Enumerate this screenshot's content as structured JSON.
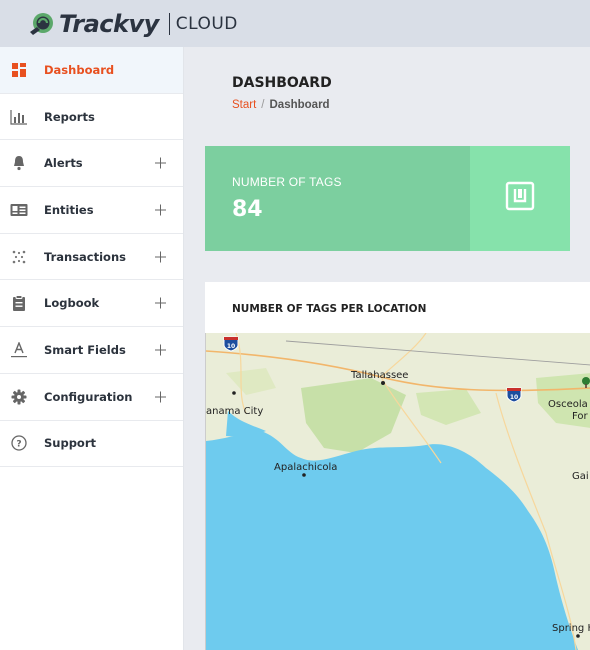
{
  "brand": {
    "name": "Trackvy",
    "product": "CLOUD"
  },
  "colors": {
    "accent": "#e8501f",
    "card_primary": "#7ccf9f",
    "card_secondary": "#86e2ab",
    "water": "#6ecbee",
    "land": "#e9ecd6"
  },
  "sidebar": {
    "items": [
      {
        "label": "Dashboard",
        "icon": "dashboard-icon",
        "active": true,
        "expandable": false
      },
      {
        "label": "Reports",
        "icon": "bar-chart-icon",
        "active": false,
        "expandable": false
      },
      {
        "label": "Alerts",
        "icon": "bell-icon",
        "active": false,
        "expandable": true
      },
      {
        "label": "Entities",
        "icon": "id-card-icon",
        "active": false,
        "expandable": true
      },
      {
        "label": "Transactions",
        "icon": "dots-icon",
        "active": false,
        "expandable": true
      },
      {
        "label": "Logbook",
        "icon": "clipboard-icon",
        "active": false,
        "expandable": true
      },
      {
        "label": "Smart Fields",
        "icon": "text-field-icon",
        "active": false,
        "expandable": true
      },
      {
        "label": "Configuration",
        "icon": "gear-icon",
        "active": false,
        "expandable": true
      },
      {
        "label": "Support",
        "icon": "help-icon",
        "active": false,
        "expandable": false
      }
    ]
  },
  "page": {
    "title": "DASHBOARD",
    "breadcrumb": {
      "start": "Start",
      "separator": "/",
      "current": "Dashboard"
    }
  },
  "stat_card": {
    "label": "NUMBER OF TAGS",
    "value": "84",
    "icon": "tag-icon"
  },
  "map_panel": {
    "title": "NUMBER OF TAGS PER LOCATION",
    "labels": {
      "tallahassee": "Tallahassee",
      "panama_city": "anama City",
      "apalachicola": "Apalachicola",
      "osceola": "Osceola N",
      "forest": "For",
      "gainesville": "Gai",
      "spring_hill": "Spring H",
      "i10_west": "10",
      "i10_east": "10"
    }
  }
}
